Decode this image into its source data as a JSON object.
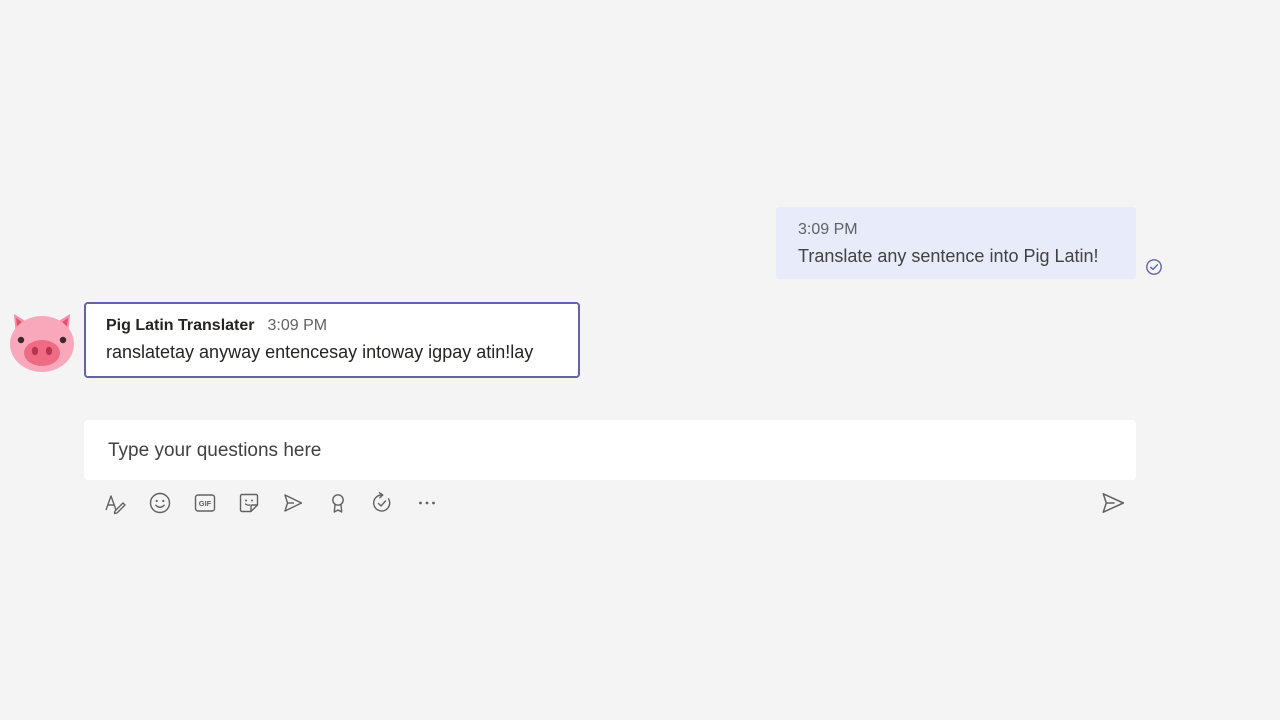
{
  "conversation": {
    "sent_message": {
      "time": "3:09 PM",
      "text": "Translate any sentence into Pig Latin!",
      "status_icon": "sent-check-icon"
    },
    "bot_message": {
      "author": "Pig Latin Translater",
      "time": "3:09 PM",
      "text": "ranslatetay anyway entencesay intoway igpay atin!lay",
      "avatar_icon": "pig-face-icon"
    }
  },
  "compose": {
    "placeholder": "Type your questions here",
    "toolbar_icons": [
      "format-icon",
      "emoji-icon",
      "gif-icon",
      "sticker-icon",
      "meet-now-icon",
      "praise-icon",
      "loop-icon",
      "more-options-icon"
    ],
    "send_icon": "send-icon"
  },
  "colors": {
    "background": "#f4f4f4",
    "sent_bubble": "#e8ebfa",
    "accent": "#6264a7"
  }
}
